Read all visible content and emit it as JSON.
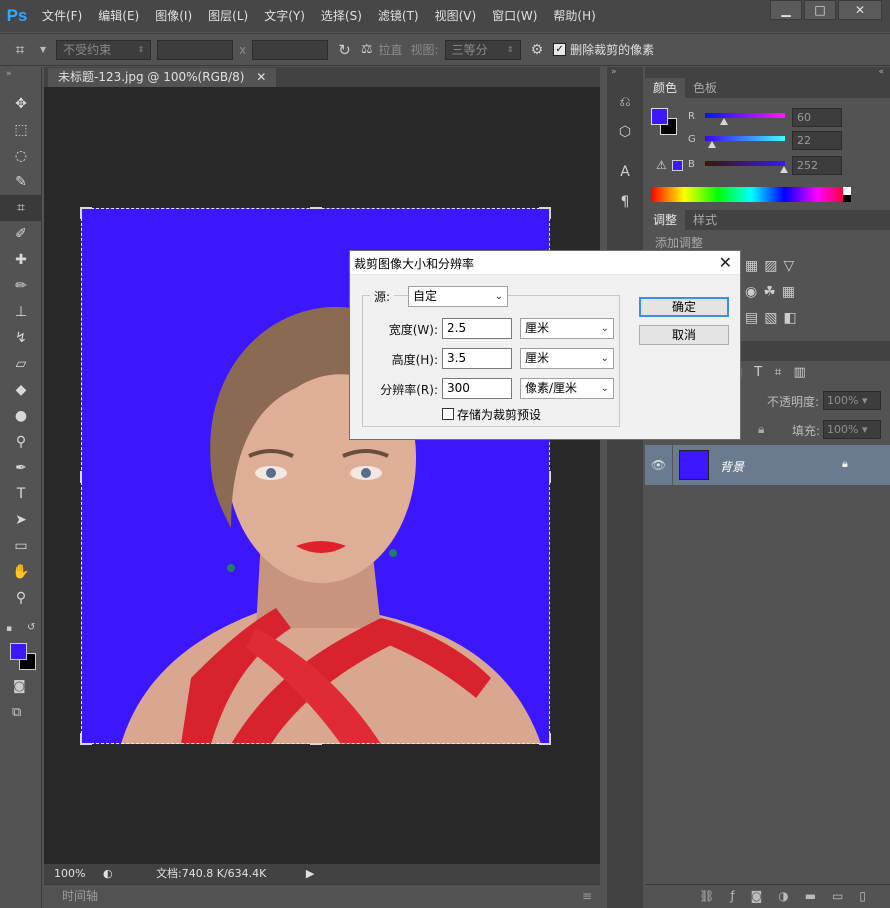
{
  "app": {
    "logo": "Ps"
  },
  "menu": [
    "文件(F)",
    "编辑(E)",
    "图像(I)",
    "图层(L)",
    "文字(Y)",
    "选择(S)",
    "滤镜(T)",
    "视图(V)",
    "窗口(W)",
    "帮助(H)"
  ],
  "window_controls": {
    "minimize": "▁",
    "maximize": "□",
    "close": "✕"
  },
  "options": {
    "constraint": "不受约束",
    "x_sep": "x",
    "straighten": "拉直",
    "view_label": "视图:",
    "view_value": "三等分",
    "delete_cropped": "删除裁剪的像素"
  },
  "document": {
    "tab_title": "未标题-123.jpg @ 100%(RGB/8)",
    "zoom": "100%",
    "doc_info": "文档:740.8 K/634.4K"
  },
  "timeline": {
    "label": "时间轴"
  },
  "color_panel": {
    "tabs": [
      "颜色",
      "色板"
    ],
    "active_tab": 0,
    "fg_color": "#3c16fc",
    "bg_color": "#000000",
    "r": {
      "label": "R",
      "value": "60",
      "fraction": 0.235
    },
    "g": {
      "label": "G",
      "value": "22",
      "fraction": 0.086
    },
    "b": {
      "label": "B",
      "value": "252",
      "fraction": 0.988
    }
  },
  "adjust_panel": {
    "tabs": [
      "调整",
      "样式"
    ],
    "add_label": "添加调整"
  },
  "layers_panel": {
    "opacity_label": "不透明度:",
    "opacity_value": "100%",
    "fill_label": "填充:",
    "fill_value": "100%",
    "layer_name": "背景"
  },
  "dialog": {
    "title": "裁剪图像大小和分辨率",
    "source_label": "源:",
    "source_value": "自定",
    "width_label": "宽度(W):",
    "width_value": "2.5",
    "width_unit": "厘米",
    "height_label": "高度(H):",
    "height_value": "3.5",
    "height_unit": "厘米",
    "resolution_label": "分辨率(R):",
    "resolution_value": "300",
    "resolution_unit": "像素/厘米",
    "save_preset": "存储为裁剪预设",
    "ok": "确定",
    "cancel": "取消"
  }
}
